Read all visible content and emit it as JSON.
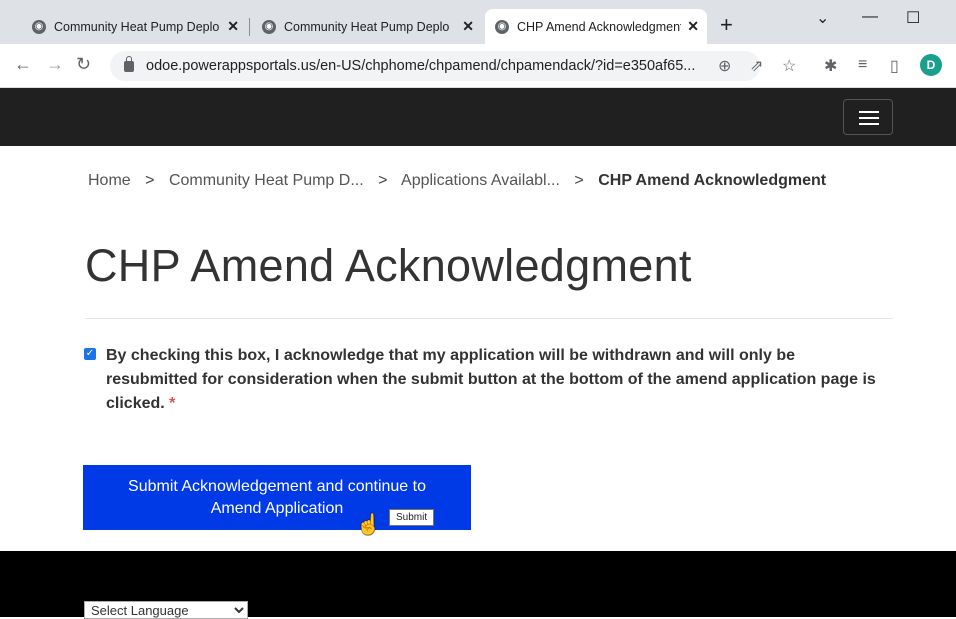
{
  "browser": {
    "tabs": [
      {
        "title": "Community Heat Pump Deplo",
        "close": "✕"
      },
      {
        "title": "Community Heat Pump Deplo",
        "close": "✕"
      },
      {
        "title": "CHP Amend Acknowledgment",
        "close": "✕"
      }
    ],
    "new_tab": "+",
    "window_controls": {
      "minimize": "—",
      "maximize": "☐",
      "chevron": "⌄"
    },
    "url": "odoe.powerappsportals.us/en-US/chphome/chpamend/chpamendack/?id=e350af65...",
    "profile_initial": "D"
  },
  "breadcrumb": {
    "items": [
      "Home",
      "Community Heat Pump D...",
      "Applications Availabl..."
    ],
    "current": "CHP Amend Acknowledgment",
    "separator": ">"
  },
  "page": {
    "title": "CHP Amend Acknowledgment",
    "acknowledgment": {
      "checked": true,
      "text": "By checking this box, I acknowledge that my application will be withdrawn and will only be resubmitted for consideration when the submit button at the bottom of the amend application page is clicked.",
      "required_marker": "*"
    },
    "submit_button": {
      "label_line1": "Submit Acknowledgement and continue to",
      "label_line2": "Amend Application",
      "tooltip": "Submit"
    }
  },
  "footer": {
    "language_select": "Select Language"
  },
  "colors": {
    "submit_bg": "#0039e6",
    "header_bg": "#202020",
    "footer_bg": "#000000",
    "checkbox": "#1a73e8"
  }
}
